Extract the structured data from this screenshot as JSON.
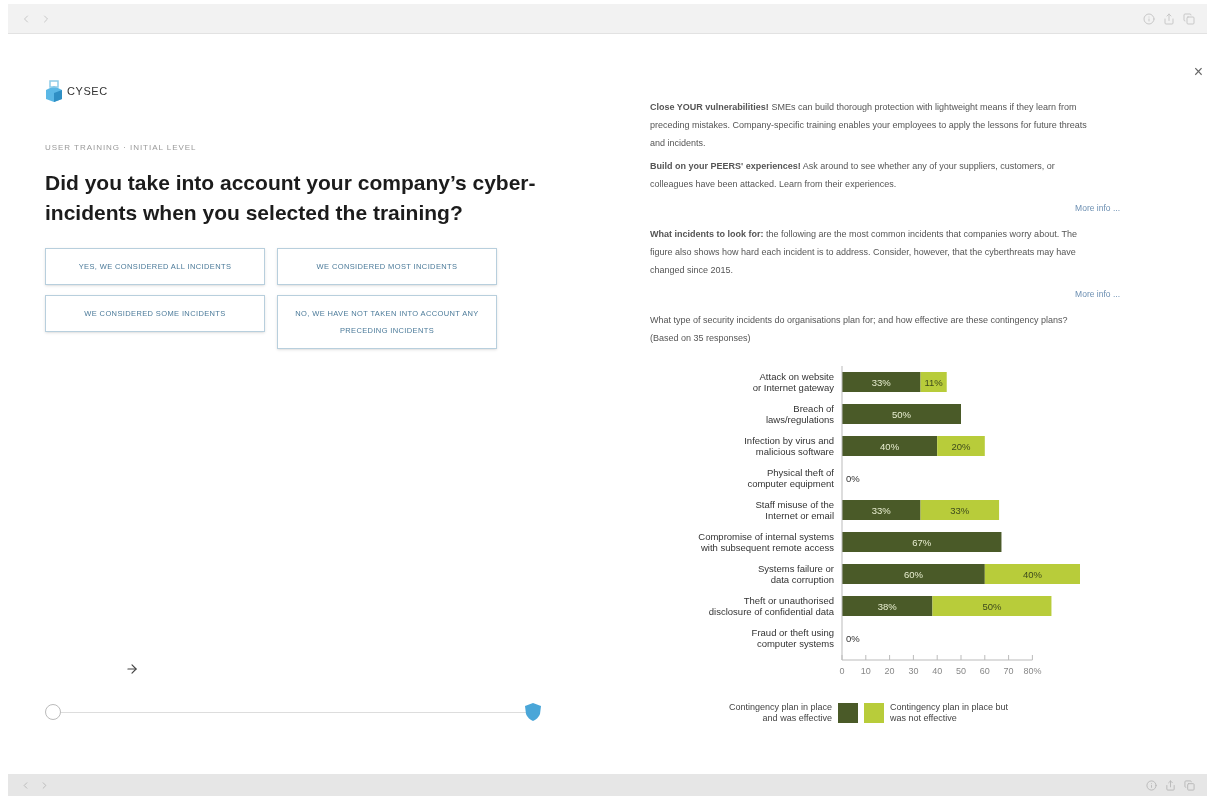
{
  "logo": {
    "text": "CYSEC"
  },
  "close_label": "×",
  "breadcrumb": "USER TRAINING · INITIAL LEVEL",
  "question": "Did you take into account your company’s cyber-incidents when you selected the training?",
  "answers": [
    {
      "label": "YES, WE CONSIDERED ALL INCIDENTS",
      "selected": false
    },
    {
      "label": "WE CONSIDERED MOST INCIDENTS",
      "selected": false
    },
    {
      "label": "WE CONSIDERED SOME INCIDENTS",
      "selected": false
    },
    {
      "label": "NO, WE HAVE NOT TAKEN INTO ACCOUNT ANY PRECEDING INCIDENTS",
      "selected": false
    }
  ],
  "info_blocks": [
    {
      "kind": "paragraph",
      "text": "**Close YOUR vulnerabilities!** SMEs can build thorough protection with lightweight means if they learn from preceding mistakes. Company-specific training enables your employees to apply the lessons for future threats and incidents."
    },
    {
      "kind": "paragraph",
      "text": "**Build on your PEERS' experiences!** Ask around to see whether any of your suppliers, customers, or colleagues have been attacked. Learn from their experiences."
    },
    {
      "kind": "link",
      "text": "More info ..."
    },
    {
      "kind": "paragraph",
      "text": "**What incidents to look for:** the following are the most common incidents that companies worry about. The figure also shows how hard each incident is to address. Consider, however, that the cyberthreats may have changed since 2015."
    },
    {
      "kind": "link",
      "text": "More info ..."
    },
    {
      "kind": "paragraph",
      "text": "What type of security incidents do organisations plan for; and how effective are these contingency plans? (Based on 35 responses)"
    }
  ],
  "chart_data": {
    "type": "bar",
    "orientation": "horizontal",
    "stacked": true,
    "value_labels": [
      [
        "33%",
        "50%",
        "40%",
        "0%",
        "33%",
        "67%",
        "60%",
        "38%",
        "0%"
      ],
      [
        "11%",
        null,
        "20%",
        null,
        "33%",
        null,
        "40%",
        "50%",
        null
      ]
    ],
    "categories": [
      "Attack on website or Internet gateway",
      "Breach of laws/regulations",
      "Infection by virus and malicious software",
      "Physical theft of computer equipment",
      "Staff misuse of the Internet or email",
      "Compromise of internal systems with subsequent remote access",
      "Systems failure or data corruption",
      "Theft or unauthorised disclosure of confidential data",
      "Fraud or theft using computer systems"
    ],
    "series": [
      {
        "name": "Contingency plan in place and was effective",
        "color": "#4a5a28",
        "values": [
          33,
          50,
          40,
          0,
          33,
          67,
          60,
          38,
          0
        ]
      },
      {
        "name": "Contingency plan in place but was not effective",
        "color": "#b8cc3a",
        "values": [
          11,
          0,
          20,
          0,
          33,
          0,
          40,
          50,
          0
        ]
      }
    ],
    "xlim": [
      0,
      100
    ],
    "xticks": [
      0,
      10,
      20,
      30,
      40,
      50,
      60,
      70,
      {
        "value": 80,
        "label": "80%"
      }
    ]
  }
}
